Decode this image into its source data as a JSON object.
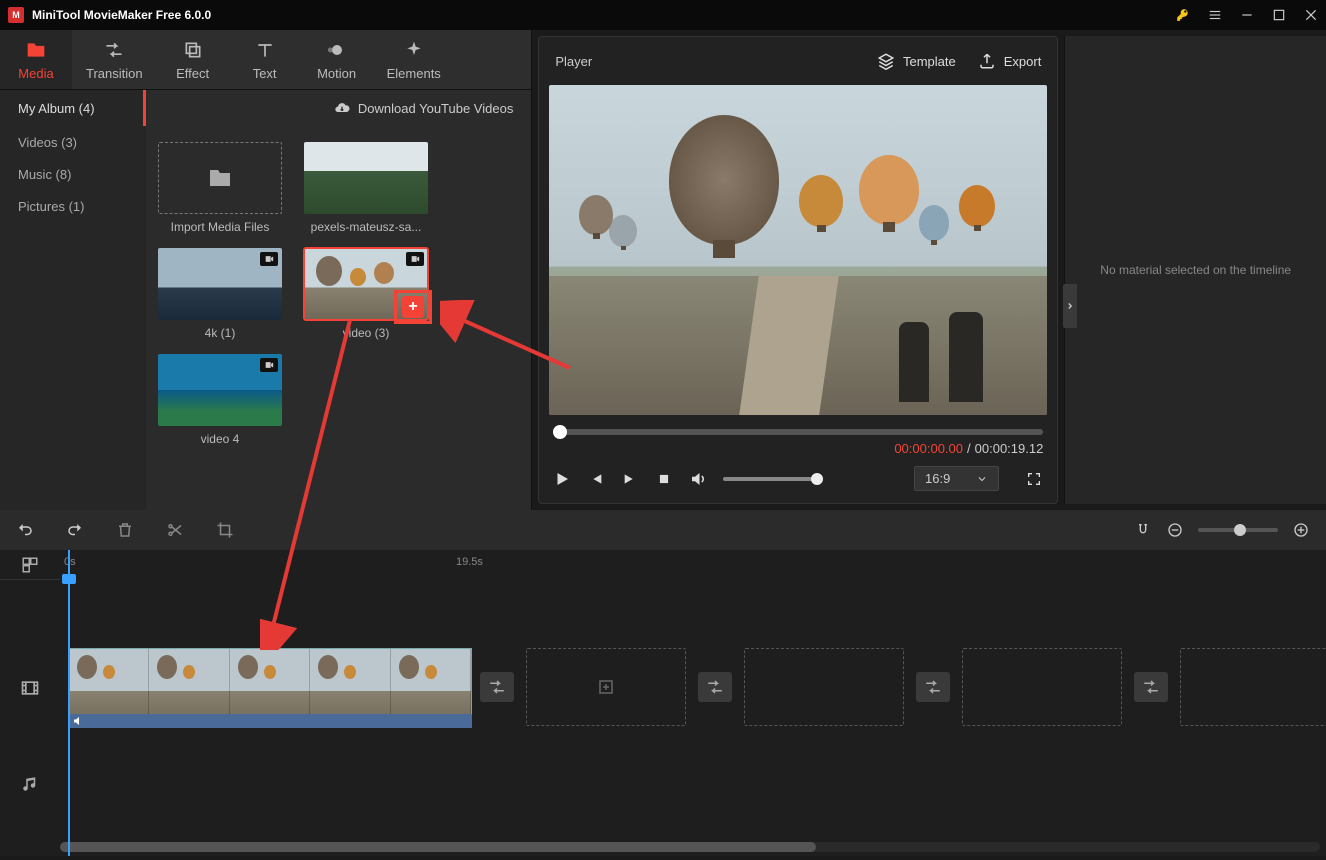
{
  "app": {
    "title": "MiniTool MovieMaker Free 6.0.0"
  },
  "toolTabs": {
    "media": "Media",
    "transition": "Transition",
    "effect": "Effect",
    "text": "Text",
    "motion": "Motion",
    "elements": "Elements"
  },
  "albumHeader": {
    "myAlbum": "My Album (4)",
    "download": "Download YouTube Videos"
  },
  "sideList": {
    "videos": "Videos (3)",
    "music": "Music (8)",
    "pictures": "Pictures (1)"
  },
  "mediaItems": {
    "import": "Import Media Files",
    "m1": "pexels-mateusz-sa...",
    "m2": "4k (1)",
    "m3": "video (3)",
    "m4": "video 4"
  },
  "player": {
    "title": "Player",
    "template": "Template",
    "export": "Export",
    "timeCurrent": "00:00:00.00",
    "timeSep": " / ",
    "timeTotal": "00:00:19.12",
    "aspect": "16:9"
  },
  "inspector": {
    "empty": "No material selected on the timeline"
  },
  "ruler": {
    "t0": "0s",
    "t1": "19.5s"
  }
}
